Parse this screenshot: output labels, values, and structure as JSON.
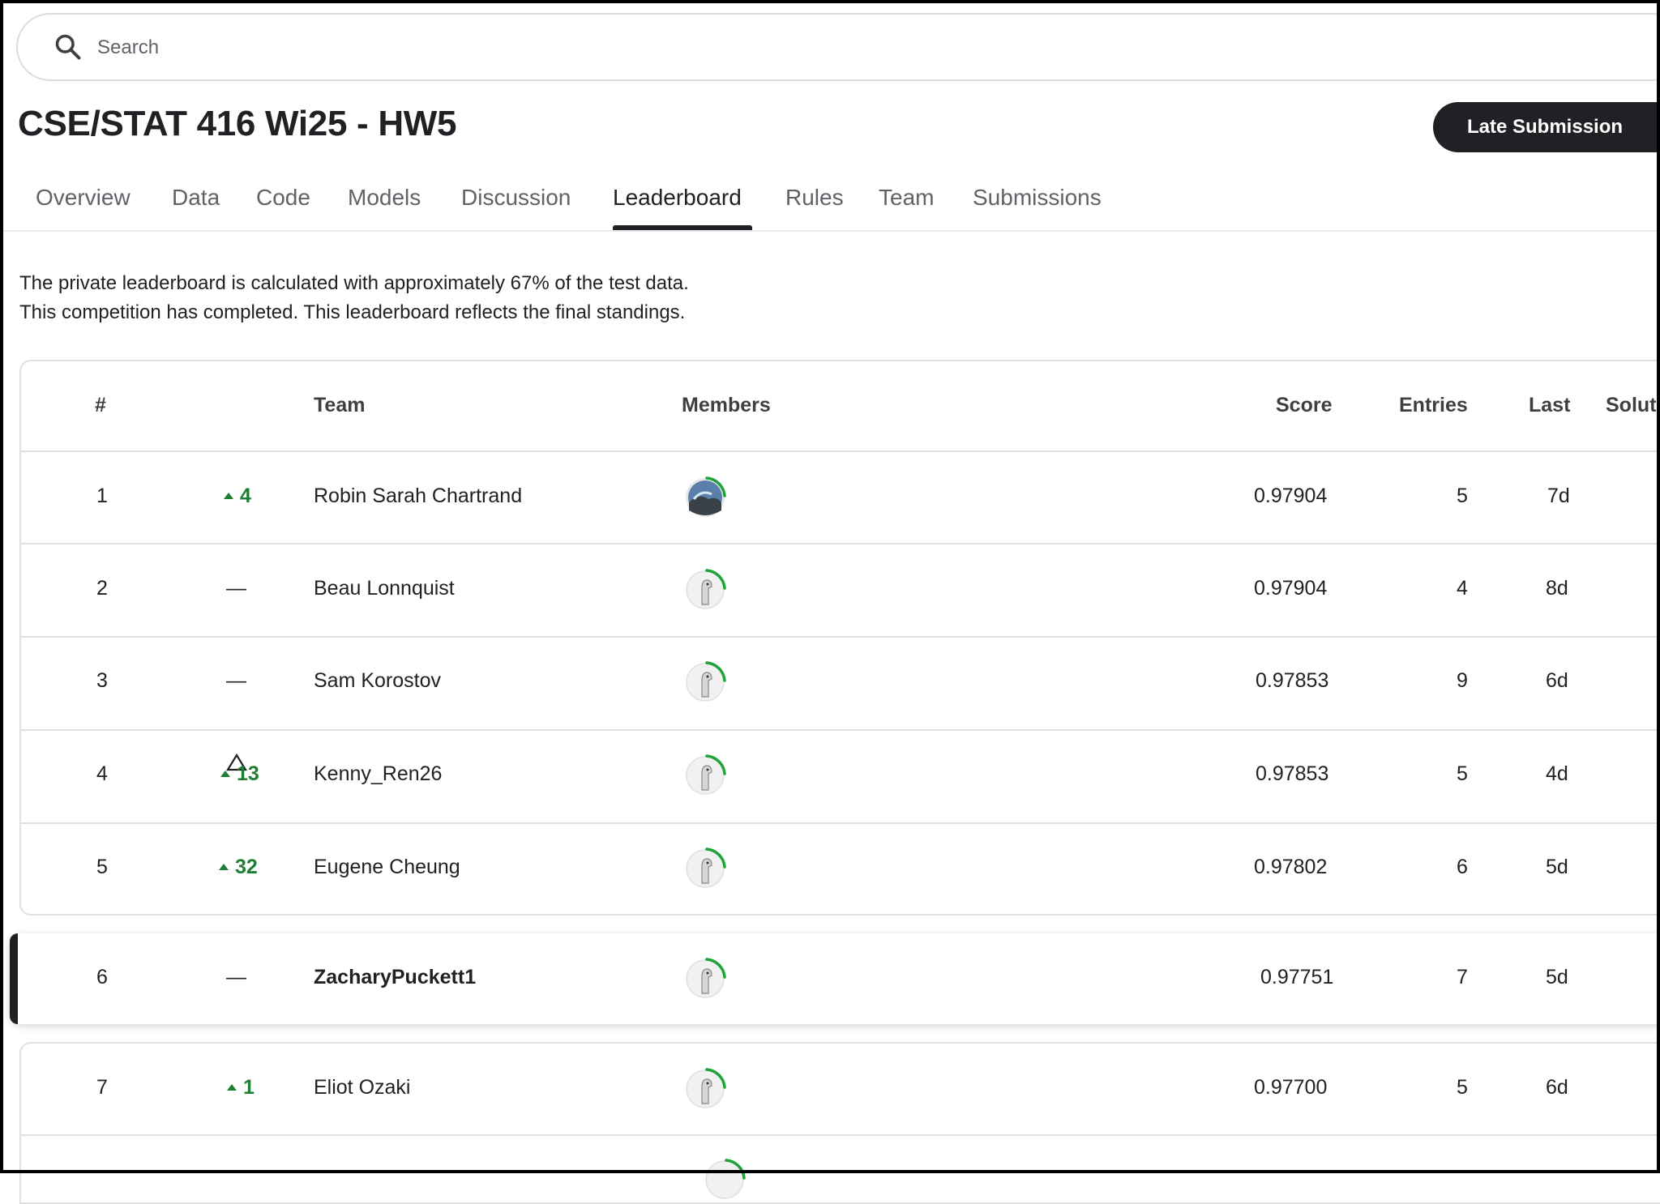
{
  "search": {
    "placeholder": "Search"
  },
  "competition": {
    "title": "CSE/STAT 416 Wi25 - HW5",
    "late_submission_label": "Late Submission"
  },
  "tabs": [
    {
      "label": "Overview",
      "active": false
    },
    {
      "label": "Data",
      "active": false
    },
    {
      "label": "Code",
      "active": false
    },
    {
      "label": "Models",
      "active": false
    },
    {
      "label": "Discussion",
      "active": false
    },
    {
      "label": "Leaderboard",
      "active": true
    },
    {
      "label": "Rules",
      "active": false
    },
    {
      "label": "Team",
      "active": false
    },
    {
      "label": "Submissions",
      "active": false
    }
  ],
  "info": {
    "line1": "The private leaderboard is calculated with approximately 67% of the test data.",
    "line2": "This competition has completed. This leaderboard reflects the final standings."
  },
  "table": {
    "headers": {
      "rank": "#",
      "delta_icon": "delta-triangle-icon",
      "team": "Team",
      "members": "Members",
      "score": "Score",
      "entries": "Entries",
      "last": "Last",
      "solution": "Solut"
    },
    "rows": [
      {
        "rank": "1",
        "delta": "4",
        "delta_dir": "up",
        "team": "Robin Sarah Chartrand",
        "avatar": "photo-avatar",
        "score": "0.97904",
        "entries": "5",
        "last": "7d"
      },
      {
        "rank": "2",
        "delta": "—",
        "delta_dir": "none",
        "team": "Beau Lonnquist",
        "avatar": "goose-avatar",
        "score": "0.97904",
        "entries": "4",
        "last": "8d"
      },
      {
        "rank": "3",
        "delta": "—",
        "delta_dir": "none",
        "team": "Sam Korostov",
        "avatar": "goose-avatar",
        "score": "0.97853",
        "entries": "9",
        "last": "6d"
      },
      {
        "rank": "4",
        "delta": "13",
        "delta_dir": "up",
        "team": "Kenny_Ren26",
        "avatar": "goose-avatar",
        "score": "0.97853",
        "entries": "5",
        "last": "4d"
      },
      {
        "rank": "5",
        "delta": "32",
        "delta_dir": "up",
        "team": "Eugene Cheung",
        "avatar": "goose-avatar",
        "score": "0.97802",
        "entries": "6",
        "last": "5d"
      }
    ],
    "my_row": {
      "rank": "6",
      "delta": "—",
      "delta_dir": "none",
      "team": "ZacharyPuckett1",
      "avatar": "goose-avatar",
      "score": "0.97751",
      "entries": "7",
      "last": "5d"
    },
    "after_rows": [
      {
        "rank": "7",
        "delta": "1",
        "delta_dir": "up",
        "team": "Eliot Ozaki",
        "avatar": "goose-avatar",
        "score": "0.97700",
        "entries": "5",
        "last": "6d"
      }
    ]
  },
  "colors": {
    "accent_dark": "#202124",
    "positive_delta": "#1e7e34",
    "avatar_ring": "#20a33a"
  }
}
